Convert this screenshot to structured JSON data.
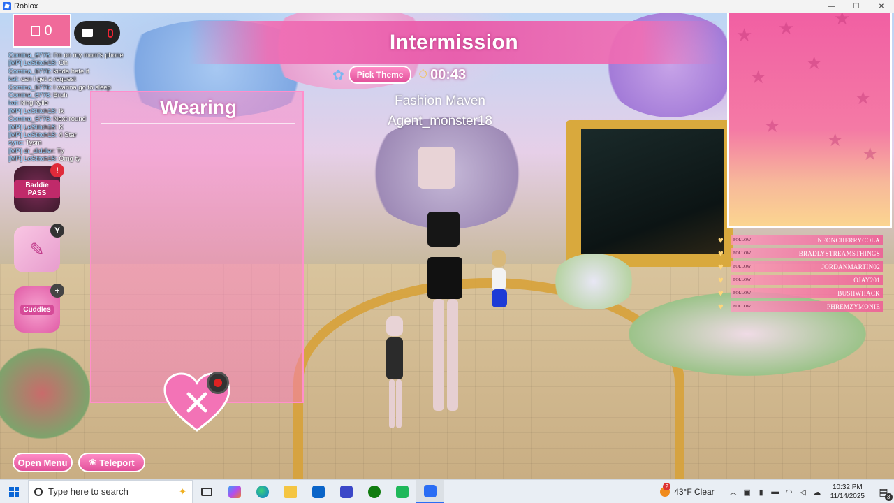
{
  "window": {
    "title": "Roblox"
  },
  "hud": {
    "counter_value": "0",
    "chat_lines": [
      {
        "name": "Comina_6776:",
        "msg": "I'm on my mom's phone"
      },
      {
        "name": "[MP] LeStitch18:",
        "msg": "Oh"
      },
      {
        "name": "Comina_6776:",
        "msg": "kinda hate it"
      },
      {
        "name": "kat:",
        "msg": "can I get a request"
      },
      {
        "name": "Comina_6776:",
        "msg": "I wanna go to sleep"
      },
      {
        "name": "Comina_6776:",
        "msg": "Bruh"
      },
      {
        "name": "kat:",
        "msg": "king kylie"
      },
      {
        "name": "[MP] LeStitch18:",
        "msg": "Ik"
      },
      {
        "name": "Comina_6776:",
        "msg": "Next round"
      },
      {
        "name": "[MP] LeStitch18:",
        "msg": "K"
      },
      {
        "name": "[MP] LeStitch18:",
        "msg": "4 Star"
      },
      {
        "name": "sync:",
        "msg": "Tysm"
      },
      {
        "name": "[MP] dr_diddler:",
        "msg": "Ty"
      },
      {
        "name": "[MP] LeStitch18:",
        "msg": "Omg ty"
      }
    ],
    "baddie_pass_label": "Baddie PASS",
    "badge_exclaim": "!",
    "badge_y": "Y",
    "cuddles_label": "Cuddles"
  },
  "banner": {
    "title": "Intermission",
    "pick_theme": "Pick Theme",
    "timer": "00:43",
    "theme_name": "Fashion Maven",
    "host_name": "Agent_monster18"
  },
  "wearing": {
    "title": "Wearing"
  },
  "buttons": {
    "open_menu": "Open Menu",
    "teleport": "Teleport"
  },
  "followers": [
    {
      "label": "FOLLOW",
      "name": "NEONCHERRYCOLA"
    },
    {
      "label": "FOLLOW",
      "name": "BRADLYSTREAMSTHINGS"
    },
    {
      "label": "FOLLOW",
      "name": "JORDANMARTIN02"
    },
    {
      "label": "FOLLOW",
      "name": "OJAY201"
    },
    {
      "label": "FOLLOW",
      "name": "BUSHWHACK"
    },
    {
      "label": "FOLLOW",
      "name": "PHREMZYMONIE"
    }
  ],
  "taskbar": {
    "search_placeholder": "Type here to search",
    "weather": "43°F  Clear",
    "time": "10:32 PM",
    "date": "11/14/2025",
    "notification_count": "3"
  },
  "colors": {
    "accent_pink": "#e2509a",
    "banner_pink": "#e85aaa",
    "taskbar_bg": "#e9eef4"
  }
}
